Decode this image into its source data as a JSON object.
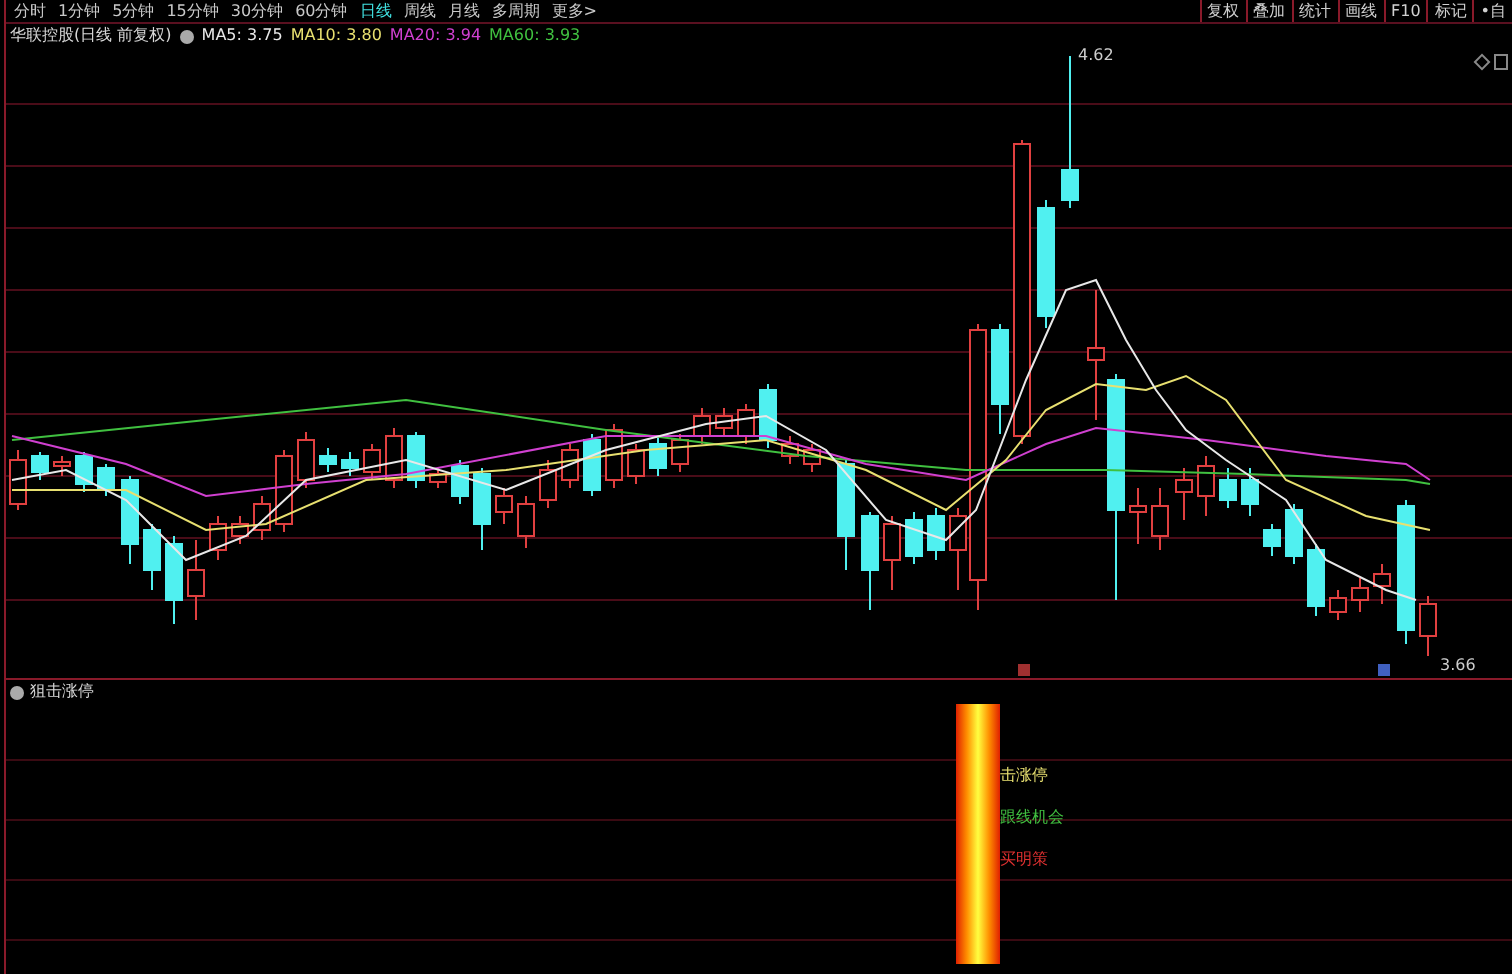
{
  "period_tabs": [
    {
      "label": "分时",
      "selected": false
    },
    {
      "label": "1分钟",
      "selected": false
    },
    {
      "label": "5分钟",
      "selected": false
    },
    {
      "label": "15分钟",
      "selected": false
    },
    {
      "label": "30分钟",
      "selected": false
    },
    {
      "label": "60分钟",
      "selected": false
    },
    {
      "label": "日线",
      "selected": true
    },
    {
      "label": "周线",
      "selected": false
    },
    {
      "label": "月线",
      "selected": false
    },
    {
      "label": "多周期",
      "selected": false
    },
    {
      "label": "更多>",
      "selected": false
    }
  ],
  "toolbar_buttons": [
    "复权",
    "叠加",
    "统计",
    "画线",
    "F10",
    "标记",
    "•自"
  ],
  "chart_header": {
    "title": "华联控股(日线 前复权)",
    "moving_averages": [
      {
        "label": "MA5: 3.75",
        "color": "#e8e8e8"
      },
      {
        "label": "MA10: 3.80",
        "color": "#e8e070"
      },
      {
        "label": "MA20: 3.94",
        "color": "#d040d0"
      },
      {
        "label": "MA60: 3.93",
        "color": "#40c040"
      }
    ]
  },
  "price_labels": {
    "high": "4.62",
    "low": "3.66"
  },
  "indicator": {
    "title": "狙击涨停",
    "signals": [
      {
        "label": "击涨停",
        "color": "#e8e070"
      },
      {
        "label": "跟线机会",
        "color": "#40c040"
      },
      {
        "label": "买明策",
        "color": "#e03030"
      }
    ]
  }
}
